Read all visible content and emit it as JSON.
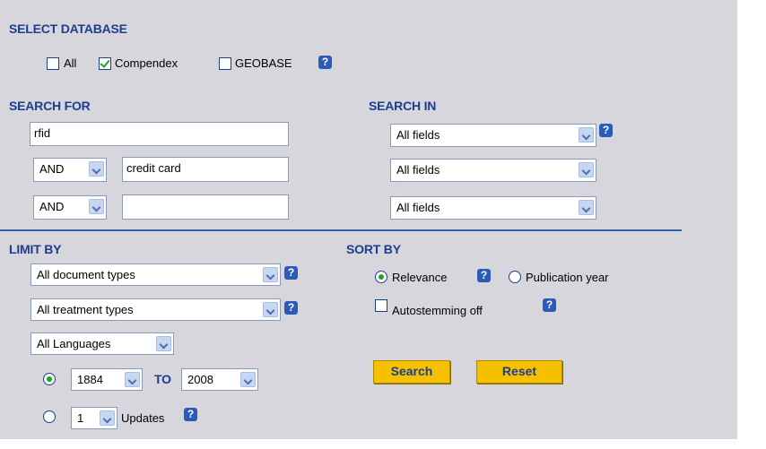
{
  "select_database": {
    "heading": "SELECT DATABASE",
    "all_label": "All",
    "compendex_label": "Compendex",
    "geobase_label": "GEOBASE",
    "help": "?",
    "all_checked": false,
    "compendex_checked": true,
    "geobase_checked": false
  },
  "search_for": {
    "heading": "SEARCH FOR",
    "term1": "rfid",
    "row2_operator": "AND",
    "term2": "credit card",
    "row3_operator": "AND",
    "term3": ""
  },
  "search_in": {
    "heading": "SEARCH IN",
    "field1": "All fields",
    "field2": "All fields",
    "field3": "All fields",
    "help": "?"
  },
  "limit_by": {
    "heading": "LIMIT BY",
    "document_types": "All document types",
    "treatment_types": "All treatment types",
    "languages": "All Languages",
    "help": "?",
    "year_from": "1884",
    "to_label": "TO",
    "year_to": "2008",
    "updates_count": "1",
    "updates_label": "Updates",
    "year_range_selected": true
  },
  "sort_by": {
    "heading": "SORT BY",
    "relevance_label": "Relevance",
    "publication_year_label": "Publication year",
    "autostemming_label": "Autostemming off",
    "help": "?",
    "relevance_selected": true
  },
  "buttons": {
    "search_label": "Search",
    "reset_label": "Reset"
  },
  "colors": {
    "panel": "#d6d6dc",
    "heading": "#1c3e8f",
    "button": "#f5c000",
    "check": "#1fa41f"
  }
}
